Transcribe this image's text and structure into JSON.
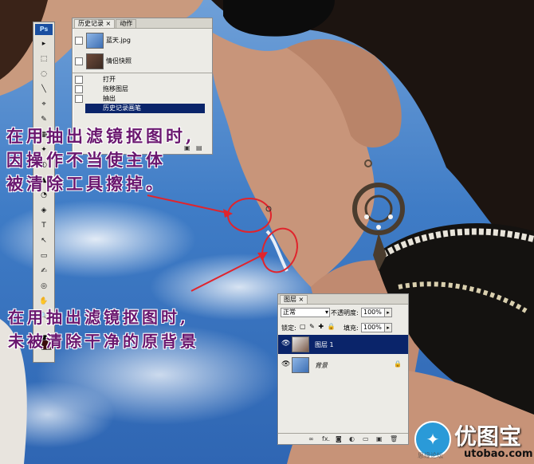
{
  "history_panel": {
    "tabs": [
      "历史记录",
      "动作"
    ],
    "close_glyph": "×",
    "snapshots": [
      "蓝天.jpg",
      "情侣快照"
    ],
    "items": [
      "打开",
      "拖移图层",
      "抽出",
      "历史记录画笔"
    ]
  },
  "toolbox": {
    "logo": "Ps",
    "tool_glyphs": [
      "▸",
      "⬚",
      "◌",
      "╲",
      "⌖",
      "✎",
      "▦",
      "✦",
      "◐",
      "▲",
      "◔",
      "◈",
      "T",
      "↖",
      "▭",
      "✍",
      "◎",
      "✋",
      "🔍"
    ]
  },
  "annotations": {
    "note_top": [
      "在用抽出滤镜抠图时,",
      "因操作不当使主体",
      "被清除工具擦掉。"
    ],
    "note_bottom": [
      "在用抽出滤镜抠图时,",
      "未被清除干净的原背景"
    ],
    "color": "#6a176f"
  },
  "layers_panel": {
    "tabs": [
      "图层"
    ],
    "close_glyph": "×",
    "blend_mode": "正常",
    "opacity_label": "不透明度:",
    "opacity_value": "100%",
    "lock_label": "锁定:",
    "fill_label": "填充:",
    "fill_value": "100%",
    "layers": [
      {
        "name": "图层 1",
        "selected": true
      },
      {
        "name": "背景",
        "selected": false,
        "locked": true
      }
    ],
    "footer_icons": [
      "link-icon",
      "fx-icon",
      "mask-icon",
      "adjustment-icon",
      "folder-icon",
      "new-layer-icon",
      "trash-icon"
    ],
    "footer_glyphs": [
      "∞",
      "fx.",
      "◙",
      "◐",
      "▭",
      "▣",
      "🗑"
    ]
  },
  "watermark": {
    "site_cn": "优图宝",
    "site_en": "utobao.com",
    "faint_text": "思缘论坛"
  },
  "colors": {
    "annotation": "#6a176f",
    "highlight_circle": "#e0242c",
    "selection": "#0a246a",
    "panel_bg": "#ecebe6"
  }
}
